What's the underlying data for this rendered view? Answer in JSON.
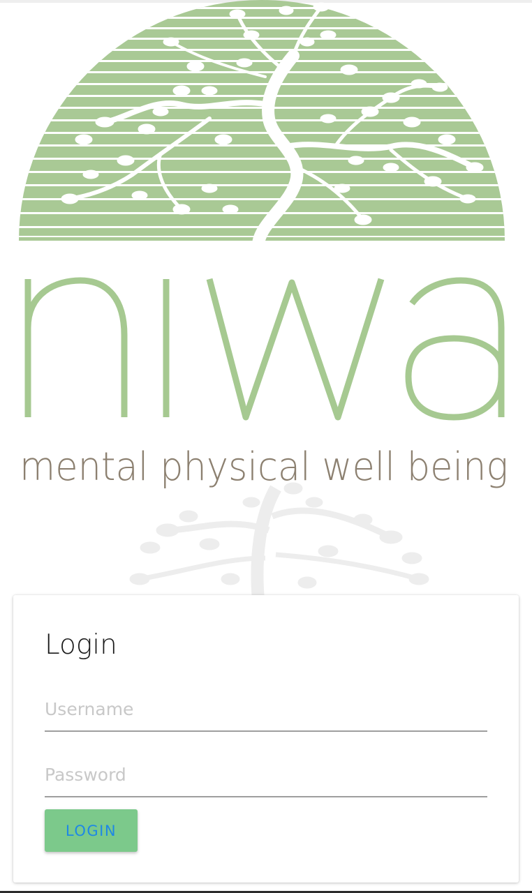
{
  "brand": {
    "logo_text": "niwa",
    "tagline": "mental physical well being",
    "colors": {
      "accent_green": "#a9c995",
      "logo_text_green": "#a6c991",
      "tagline_brown": "#8c8070"
    }
  },
  "login": {
    "title": "Login",
    "username_placeholder": "Username",
    "password_placeholder": "Password",
    "button_label": "LOGIN",
    "colors": {
      "button_bg": "#7cc98b",
      "button_text": "#1e88e5"
    }
  }
}
